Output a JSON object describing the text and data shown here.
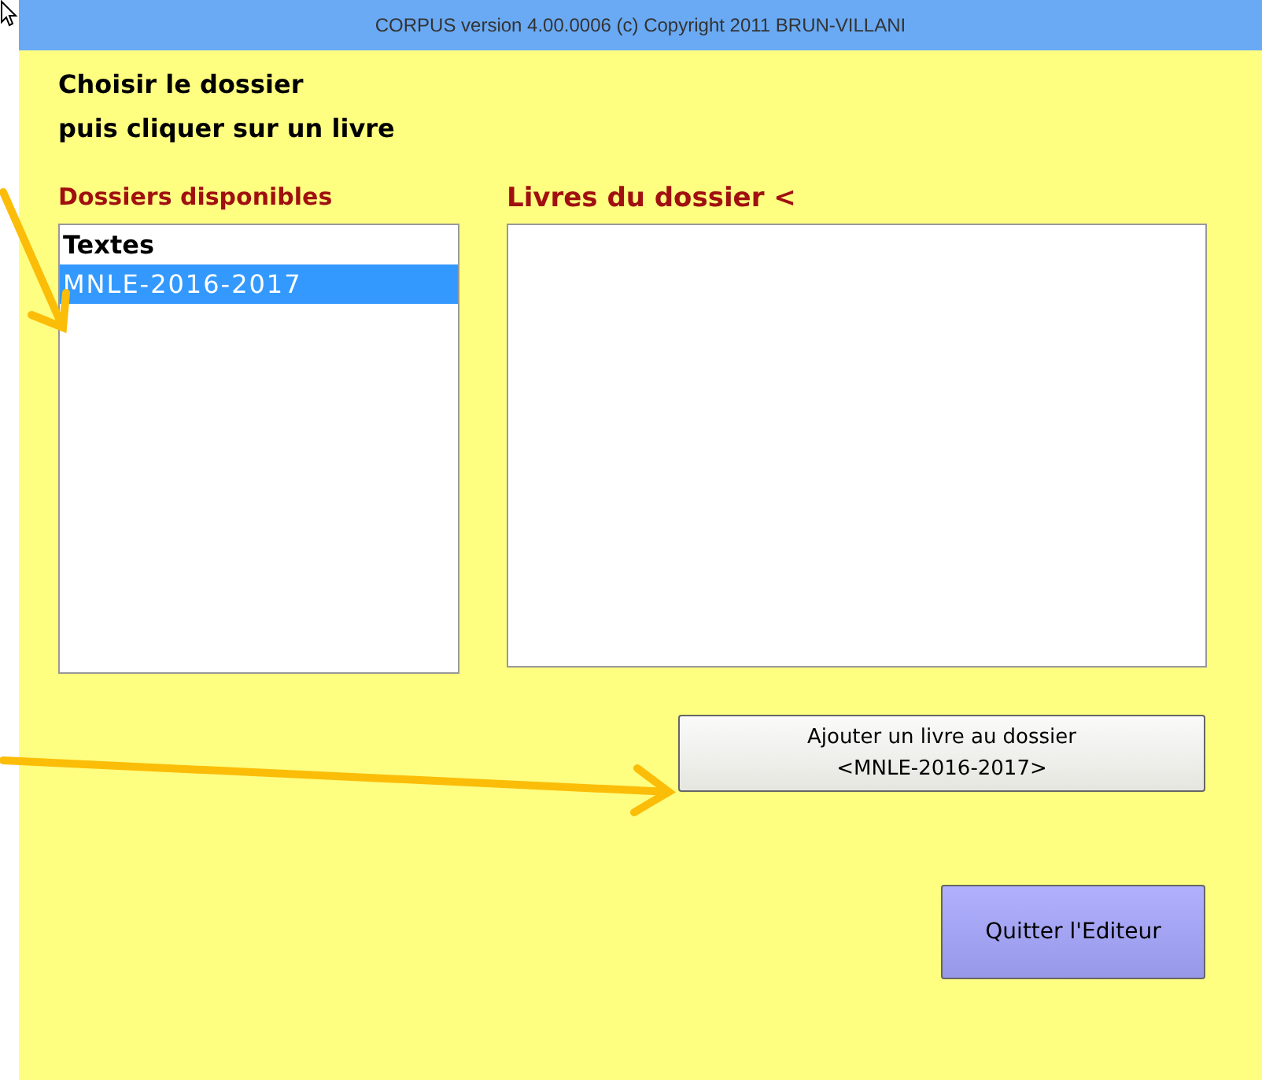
{
  "window": {
    "title": "CORPUS version 4.00.0006 (c) Copyright 2011 BRUN-VILLANI"
  },
  "instructions": [
    "Choisir le dossier",
    "puis cliquer sur un livre"
  ],
  "folders": {
    "label": "Dossiers disponibles",
    "items": [
      {
        "label": "Textes",
        "selected": false
      },
      {
        "label": "MNLE-2016-2017",
        "selected": true
      }
    ]
  },
  "books": {
    "label": "Livres du dossier <"
  },
  "buttons": [
    {
      "kind": "add",
      "label": "Ajouter un livre au dossier\n<MNLE-2016-2017>"
    },
    {
      "kind": "quit",
      "label": "Quitter l'Editeur"
    }
  ]
}
